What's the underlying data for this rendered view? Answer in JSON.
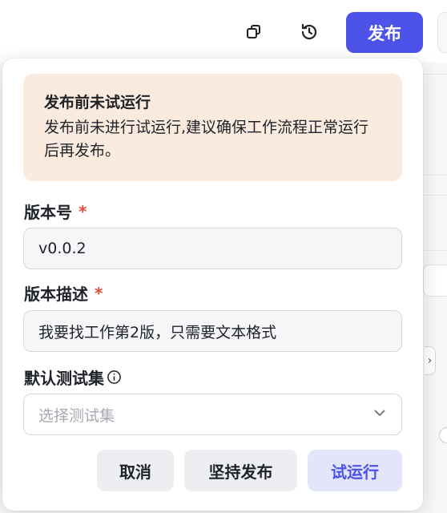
{
  "header": {
    "publish_label": "发布",
    "icons": [
      "copy-icon",
      "history-icon"
    ]
  },
  "dialog": {
    "warning": {
      "title": "发布前未试运行",
      "body": "发布前未进行试运行,建议确保工作流程正常运行后再发布。"
    },
    "version": {
      "label": "版本号",
      "required_mark": "*",
      "value": "v0.0.2"
    },
    "description": {
      "label": "版本描述",
      "required_mark": "*",
      "value": "我要找工作第2版，只需要文本格式"
    },
    "testset": {
      "label": "默认测试集",
      "placeholder": "选择测试集"
    },
    "buttons": {
      "cancel": "取消",
      "force_publish": "坚持发布",
      "trial_run": "试运行"
    }
  },
  "colors": {
    "accent": "#4d53e8",
    "warning_bg": "#fbeade",
    "required": "#e5483b"
  }
}
